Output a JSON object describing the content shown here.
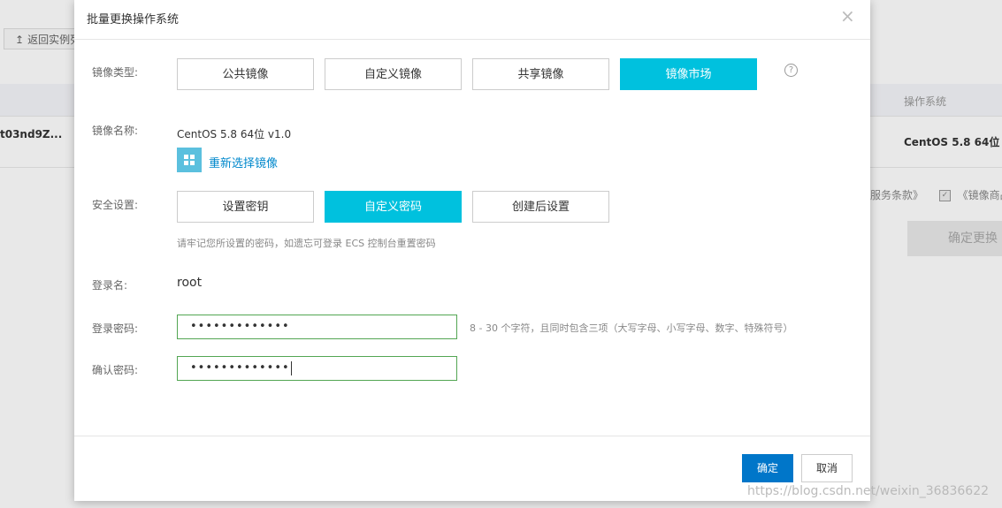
{
  "background": {
    "back_label": "返回实例列",
    "instance_id": "t03nd9Z...",
    "os_header": "操作系统",
    "os_value": "CentOS 5.8 64位",
    "terms_left": "服务条款》",
    "terms_right": "《镜像商品使",
    "confirm_change": "确定更换"
  },
  "dialog": {
    "title": "批量更换操作系统",
    "close_glyph": "×",
    "image_type_label": "镜像类型:",
    "image_type_options": [
      "公共镜像",
      "自定义镜像",
      "共享镜像",
      "镜像市场"
    ],
    "image_type_selected": "镜像市场",
    "help_glyph": "?",
    "image_name_label": "镜像名称:",
    "image_name": "CentOS 5.8 64位 v1.0",
    "reselect_label": "重新选择镜像",
    "security_label": "安全设置:",
    "security_options": [
      "设置密钥",
      "自定义密码",
      "创建后设置"
    ],
    "security_selected": "自定义密码",
    "security_hint": "请牢记您所设置的密码，如遗忘可登录 ECS 控制台重置密码",
    "login_name_label": "登录名:",
    "login_name": "root",
    "password_label": "登录密码:",
    "password_value": "•••••••••••••",
    "password_hint": "8 - 30 个字符，且同时包含三项（大写字母、小写字母、数字、特殊符号）",
    "confirm_label": "确认密码:",
    "confirm_value": "•••••••••••••",
    "ok_label": "确定",
    "cancel_label": "取消"
  },
  "watermark": "https://blog.csdn.net/weixin_36836622",
  "colors": {
    "accent": "#00c1de",
    "primary_button": "#0076c9",
    "link": "#0088cc",
    "input_border_valid": "#53a653"
  }
}
